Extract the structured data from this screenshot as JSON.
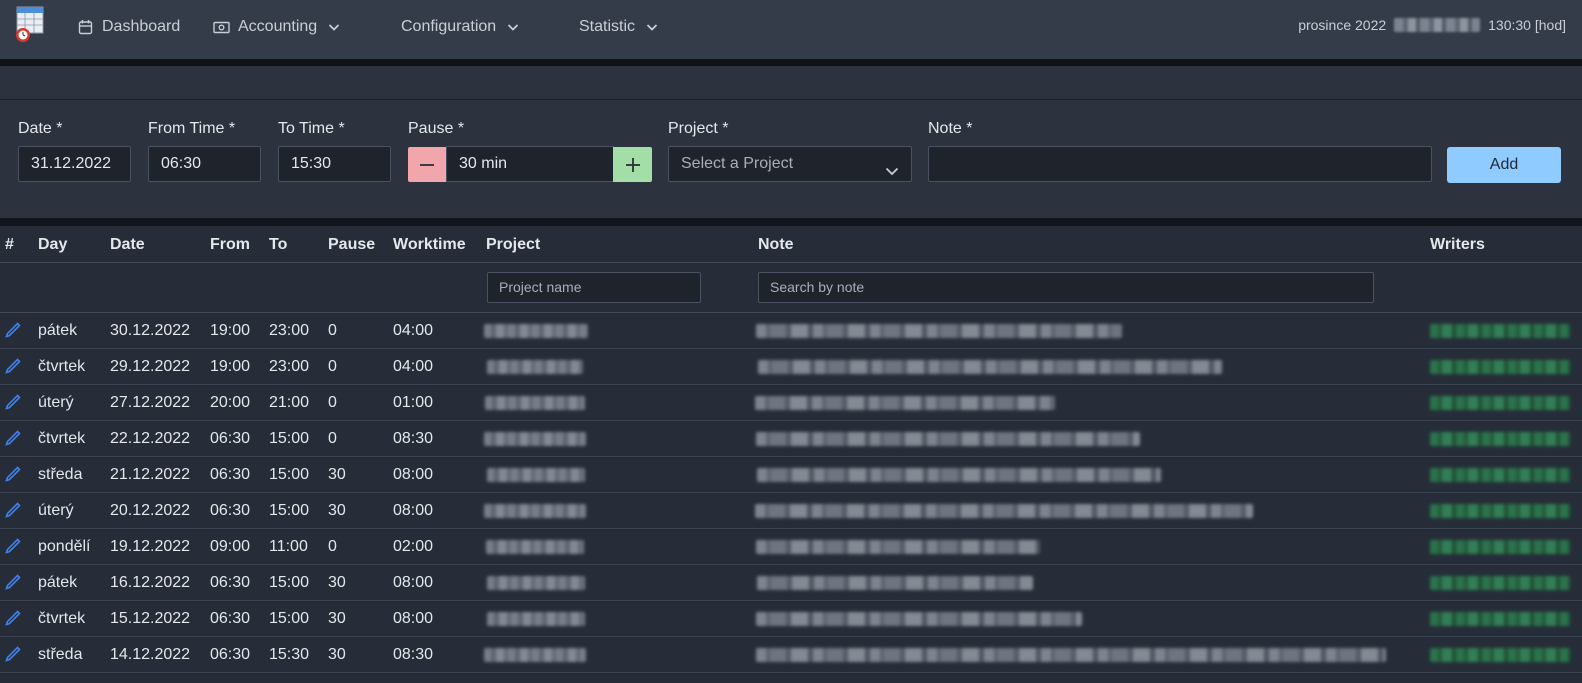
{
  "nav": {
    "items": [
      {
        "label": "Dashboard",
        "icon": "calendar-icon",
        "dropdown": false
      },
      {
        "label": "Accounting",
        "icon": "money-icon",
        "dropdown": true
      },
      {
        "label": "Configuration",
        "icon": "",
        "dropdown": true
      },
      {
        "label": "Statistic",
        "icon": "",
        "dropdown": true
      }
    ],
    "period": "prosince 2022",
    "total_hours": "130:30 [hod]"
  },
  "form": {
    "date_label": "Date *",
    "date_value": "31.12.2022",
    "from_label": "From Time *",
    "from_value": "06:30",
    "to_label": "To Time *",
    "to_value": "15:30",
    "pause_label": "Pause *",
    "pause_value": "30 min",
    "project_label": "Project *",
    "project_placeholder": "Select a Project",
    "note_label": "Note *",
    "note_value": "",
    "add_label": "Add"
  },
  "table": {
    "headers": {
      "num": "#",
      "day": "Day",
      "date": "Date",
      "from": "From",
      "to": "To",
      "pause": "Pause",
      "worktime": "Worktime",
      "project": "Project",
      "note": "Note",
      "writers": "Writers"
    },
    "filters": {
      "project_placeholder": "Project name",
      "note_placeholder": "Search by note"
    },
    "rows": [
      {
        "day": "pátek",
        "date": "30.12.2022",
        "from": "19:00",
        "to": "23:00",
        "pause": "0",
        "worktime": "04:00"
      },
      {
        "day": "čtvrtek",
        "date": "29.12.2022",
        "from": "19:00",
        "to": "23:00",
        "pause": "0",
        "worktime": "04:00"
      },
      {
        "day": "úterý",
        "date": "27.12.2022",
        "from": "20:00",
        "to": "21:00",
        "pause": "0",
        "worktime": "01:00"
      },
      {
        "day": "čtvrtek",
        "date": "22.12.2022",
        "from": "06:30",
        "to": "15:00",
        "pause": "0",
        "worktime": "08:30"
      },
      {
        "day": "středa",
        "date": "21.12.2022",
        "from": "06:30",
        "to": "15:00",
        "pause": "30",
        "worktime": "08:00"
      },
      {
        "day": "úterý",
        "date": "20.12.2022",
        "from": "06:30",
        "to": "15:00",
        "pause": "30",
        "worktime": "08:00"
      },
      {
        "day": "pondělí",
        "date": "19.12.2022",
        "from": "09:00",
        "to": "11:00",
        "pause": "0",
        "worktime": "02:00"
      },
      {
        "day": "pátek",
        "date": "16.12.2022",
        "from": "06:30",
        "to": "15:00",
        "pause": "30",
        "worktime": "08:00"
      },
      {
        "day": "čtvrtek",
        "date": "15.12.2022",
        "from": "06:30",
        "to": "15:00",
        "pause": "30",
        "worktime": "08:00"
      },
      {
        "day": "středa",
        "date": "14.12.2022",
        "from": "06:30",
        "to": "15:30",
        "pause": "30",
        "worktime": "08:30"
      }
    ]
  },
  "colors": {
    "nav_bg": "#353c49",
    "page_bg": "#262d38",
    "add_button": "#8fcbff",
    "minus_button": "#f0a6aa",
    "plus_button": "#a3dea7",
    "edit_icon": "#3b82f6",
    "writer_text": "#2d7a4d"
  }
}
